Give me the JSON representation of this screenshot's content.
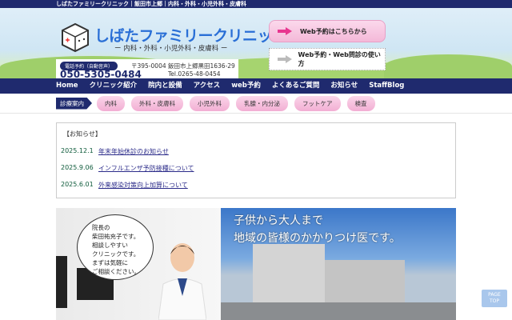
{
  "topbar": {
    "text": "しばたファミリークリニック｜飯田市上郷｜内科・外科・小児外科・皮膚科"
  },
  "header": {
    "title": "しばたファミリークリニック",
    "subtitle": "ー 内科・外科・小児外科・皮膚科 ー",
    "tel_label": "電話予約（自動音声）",
    "tel_number": "050-5305-0484",
    "address": "〒395-0004 飯田市上郷黒田1636-29",
    "tel": "Tel.0265-48-0454",
    "web_reserve_button": "Web予約はこちらから",
    "howto_button": "Web予約・Web問診の使い方"
  },
  "nav": [
    "Home",
    "クリニック紹介",
    "院内と設備",
    "アクセス",
    "web予約",
    "よくあるご質問",
    "お知らせ",
    "StaffBlog"
  ],
  "subnav": {
    "label": "診療案内",
    "items": [
      "内科",
      "外科・皮膚科",
      "小児外科",
      "乳腺・内分泌",
      "フットケア",
      "検査"
    ]
  },
  "notice": {
    "title": "【お知らせ】",
    "items": [
      {
        "date": "2025.12.1",
        "text": "年末年始休診のお知らせ"
      },
      {
        "date": "2025.9.06",
        "text": "インフルエンザ予防接種について"
      },
      {
        "date": "2025.6.01",
        "text": "外来感染対策向上加算について"
      }
    ]
  },
  "banner": {
    "bubble": [
      "院長の",
      "柴田祐充子です。",
      "相談しやすい",
      "クリニックです。",
      "まずは気軽に",
      "ご相談ください。"
    ],
    "catch": [
      "子供から大人まで",
      "地域の皆様のかかりつけ医です。"
    ]
  },
  "pagetop": [
    "PAGE",
    "TOP"
  ],
  "colors": {
    "navy": "#1f2a6e",
    "pink": "#f4b8d8",
    "title_blue": "#2a6fd6"
  }
}
